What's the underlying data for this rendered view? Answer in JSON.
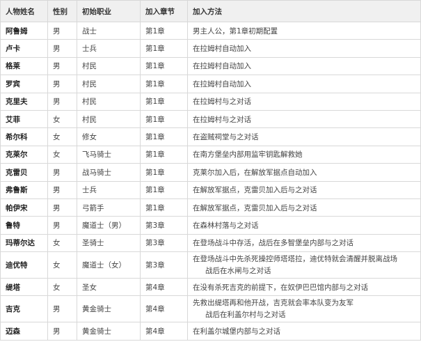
{
  "table": {
    "headers": [
      "人物姓名",
      "性别",
      "初始职业",
      "加入章节",
      "加入方法"
    ],
    "rows": [
      {
        "name": "阿鲁姆",
        "gender": "男",
        "job": "战士",
        "chapter": "第1章",
        "method": "男主人公，第1章初期配置"
      },
      {
        "name": "卢卡",
        "gender": "男",
        "job": "士兵",
        "chapter": "第1章",
        "method": "在拉姆村自动加入"
      },
      {
        "name": "格莱",
        "gender": "男",
        "job": "村民",
        "chapter": "第1章",
        "method": "在拉姆村自动加入"
      },
      {
        "name": "罗宾",
        "gender": "男",
        "job": "村民",
        "chapter": "第1章",
        "method": "在拉姆村自动加入"
      },
      {
        "name": "克里夫",
        "gender": "男",
        "job": "村民",
        "chapter": "第1章",
        "method": "在拉姆村与之对话"
      },
      {
        "name": "艾菲",
        "gender": "女",
        "job": "村民",
        "chapter": "第1章",
        "method": "在拉姆村与之对话"
      },
      {
        "name": "希尔科",
        "gender": "女",
        "job": "修女",
        "chapter": "第1章",
        "method": "在盗贼祠堂与之对话"
      },
      {
        "name": "克莱尔",
        "gender": "女",
        "job": "飞马骑士",
        "chapter": "第1章",
        "method": "在南方堡垒内部用监牢钥匙解救她"
      },
      {
        "name": "克雷贝",
        "gender": "男",
        "job": "战马骑士",
        "chapter": "第1章",
        "method": "克莱尔加入后，在解放军据点自动加入"
      },
      {
        "name": "弗鲁斯",
        "gender": "男",
        "job": "士兵",
        "chapter": "第1章",
        "method": "在解放军据点，克雷贝加入后与之对话"
      },
      {
        "name": "帕伊宋",
        "gender": "男",
        "job": "弓箭手",
        "chapter": "第1章",
        "method": "在解放军据点，克雷贝加入后与之对话"
      },
      {
        "name": "鲁特",
        "gender": "男",
        "job": "魔道士（男）",
        "chapter": "第3章",
        "method": "在森林村落与之对话"
      },
      {
        "name": "玛蒂尔达",
        "gender": "女",
        "job": "圣骑士",
        "chapter": "第3章",
        "method": "在登场战斗中存活，战后在多智堡垒内部与之对话"
      },
      {
        "name": "迪优特",
        "gender": "女",
        "job": "魔道士（女）",
        "chapter": "第3章",
        "method_line1": "在登场战斗中先杀死操控师塔塔拉，迪优特就会清醒并脱离战场",
        "method_line2": "战后在水闸与之对话"
      },
      {
        "name": "缇塔",
        "gender": "女",
        "job": "圣女",
        "chapter": "第4章",
        "method": "在没有杀死吉克的前提下，在奴伊巴巴馆内部与之对话"
      },
      {
        "name": "吉克",
        "gender": "男",
        "job": "黄金骑士",
        "chapter": "第4章",
        "method_line1": "先救出缇塔再和他开战，吉克就会率本队变为友军",
        "method_line2": "战后在利盖尔村与之对话"
      },
      {
        "name": "迈森",
        "gender": "男",
        "job": "黄金骑士",
        "chapter": "第4章",
        "method": "在利盖尔城堡内部与之对话"
      }
    ]
  }
}
